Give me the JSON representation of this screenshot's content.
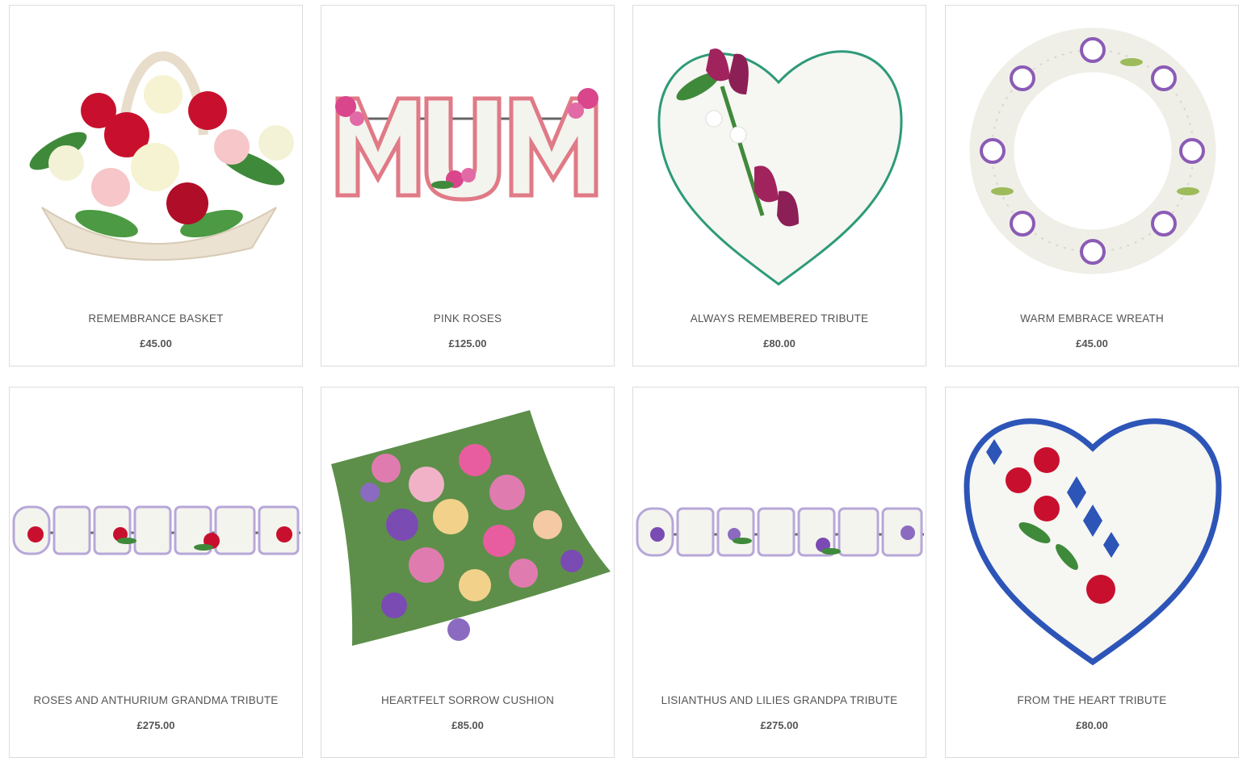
{
  "products": [
    {
      "name": "REMEMBRANCE BASKET",
      "price": "£45.00",
      "image_icon": "basket-arrangement-icon"
    },
    {
      "name": "PINK ROSES",
      "price": "£125.00",
      "image_icon": "mum-letters-tribute-icon"
    },
    {
      "name": "ALWAYS REMEMBERED TRIBUTE",
      "price": "£80.00",
      "image_icon": "white-heart-calla-icon"
    },
    {
      "name": "WARM EMBRACE WREATH",
      "price": "£45.00",
      "image_icon": "lisianthus-wreath-icon"
    },
    {
      "name": "ROSES AND ANTHURIUM GRANDMA TRIBUTE",
      "price": "£275.00",
      "image_icon": "grandma-letters-tribute-icon"
    },
    {
      "name": "HEARTFELT SORROW CUSHION",
      "price": "£85.00",
      "image_icon": "flower-cushion-icon"
    },
    {
      "name": "LISIANTHUS AND LILIES GRANDPA TRIBUTE",
      "price": "£275.00",
      "image_icon": "grandpa-letters-tribute-icon"
    },
    {
      "name": "FROM THE HEART TRIBUTE",
      "price": "£80.00",
      "image_icon": "blue-ribbon-heart-icon"
    }
  ],
  "colors": {
    "card_border": "#dcdcdc",
    "text": "#555555",
    "white_flower": "#f4f4ee",
    "red": "#c8102e",
    "pink": "#d9468c",
    "purple": "#8b5bb5",
    "blue": "#2d55b8",
    "green": "#3f8a3a"
  }
}
